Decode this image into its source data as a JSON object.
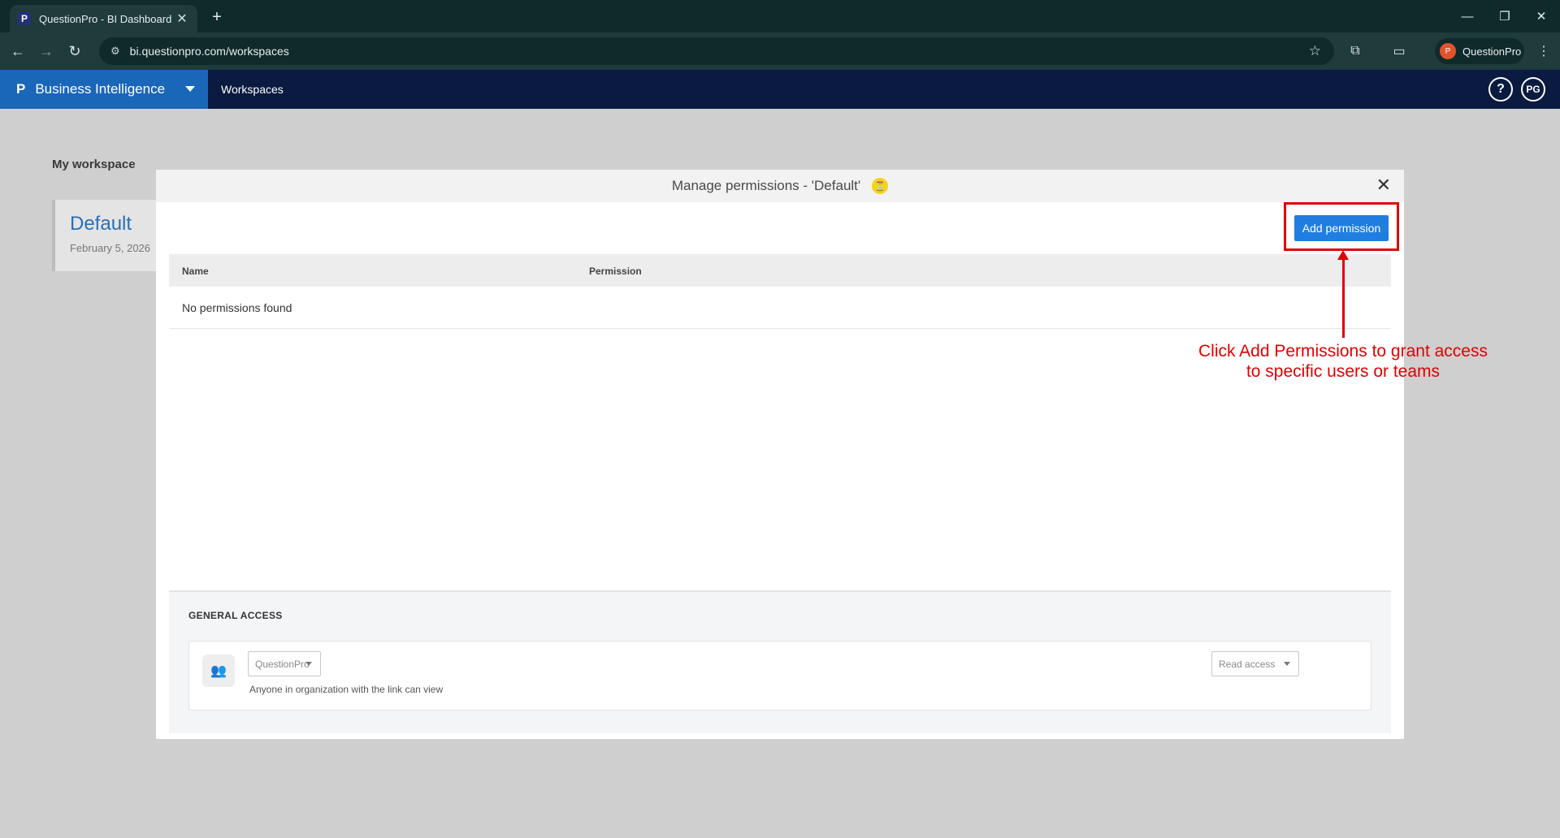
{
  "browser": {
    "tab_title": "QuestionPro - BI Dashboard",
    "tab_favicon": "P",
    "url": "bi.questionpro.com/workspaces",
    "profile_name": "QuestionPro",
    "profile_initial": "P"
  },
  "app": {
    "brand": "Business Intelligence",
    "brand_logo": "P",
    "nav_workspaces": "Workspaces",
    "help": "?",
    "user_initials": "PG"
  },
  "background": {
    "section_title": "My workspace",
    "workspace_name": "Default",
    "workspace_date": "February 5, 2026"
  },
  "modal": {
    "title": "Manage permissions - 'Default'",
    "add_button": "Add permission",
    "columns": [
      "Name",
      "Permission"
    ],
    "empty_text": "No permissions found",
    "general_access_title": "GENERAL ACCESS",
    "org_select": "QuestionPro",
    "access_select": "Read access",
    "general_desc": "Anyone in organization with the link can view"
  },
  "annotation": {
    "text": "Click Add Permissions to grant access to specific users or teams",
    "color": "#e00000"
  },
  "colors": {
    "brand_blue": "#1a66b8",
    "header_navy": "#0a1a40",
    "button_blue": "#1f7ee0"
  }
}
